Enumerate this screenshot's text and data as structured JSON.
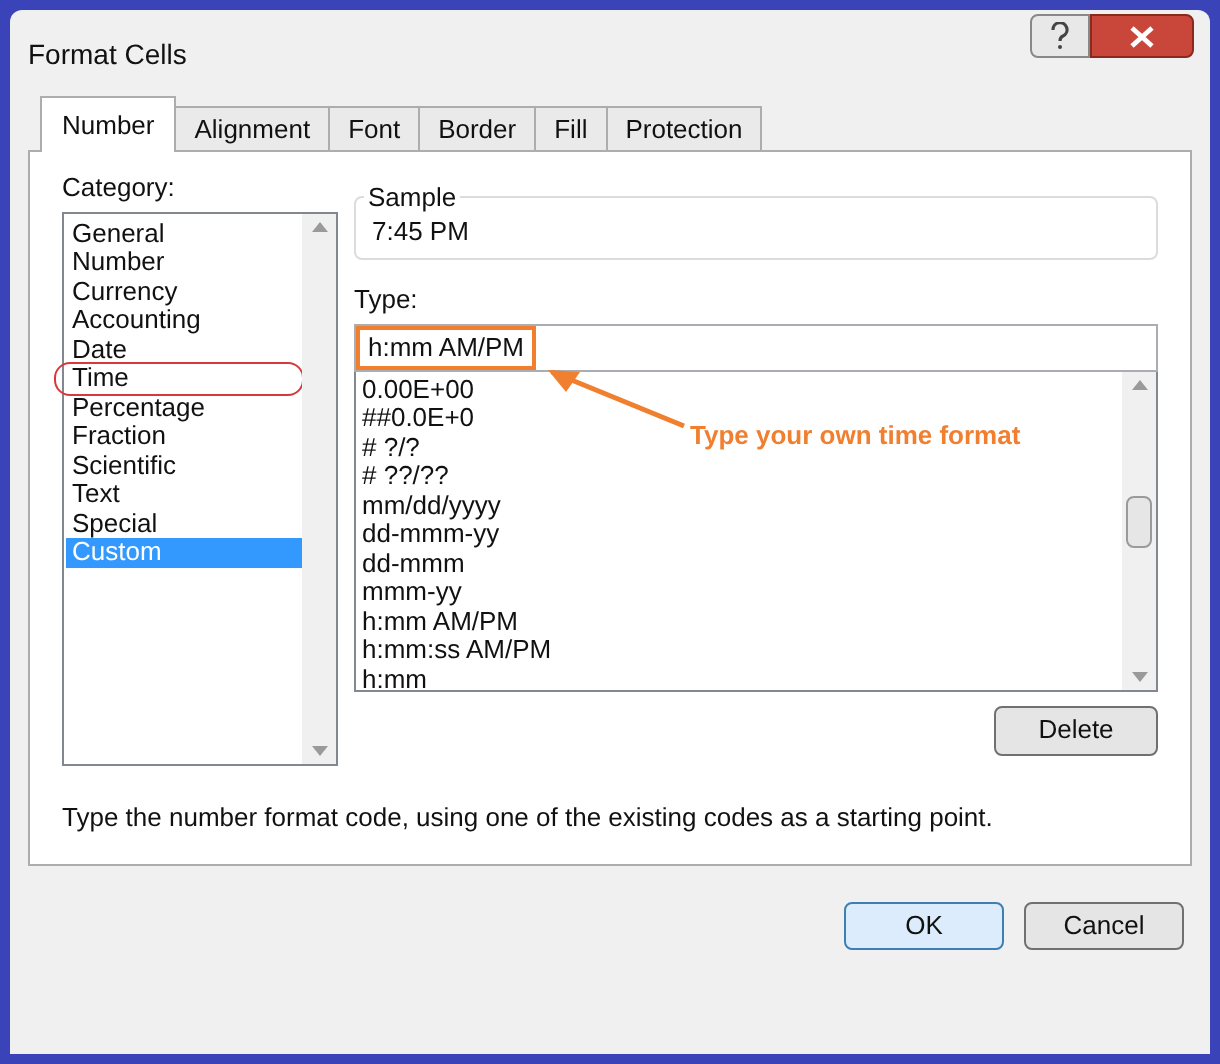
{
  "window": {
    "title": "Format Cells"
  },
  "tabs": [
    {
      "label": "Number",
      "selected": true
    },
    {
      "label": "Alignment",
      "selected": false
    },
    {
      "label": "Font",
      "selected": false
    },
    {
      "label": "Border",
      "selected": false
    },
    {
      "label": "Fill",
      "selected": false
    },
    {
      "label": "Protection",
      "selected": false
    }
  ],
  "category": {
    "label": "Category:",
    "items": [
      {
        "label": "General",
        "selected": false,
        "circled": false
      },
      {
        "label": "Number",
        "selected": false,
        "circled": false
      },
      {
        "label": "Currency",
        "selected": false,
        "circled": false
      },
      {
        "label": "Accounting",
        "selected": false,
        "circled": false
      },
      {
        "label": "Date",
        "selected": false,
        "circled": false
      },
      {
        "label": "Time",
        "selected": false,
        "circled": true
      },
      {
        "label": "Percentage",
        "selected": false,
        "circled": false
      },
      {
        "label": "Fraction",
        "selected": false,
        "circled": false
      },
      {
        "label": "Scientific",
        "selected": false,
        "circled": false
      },
      {
        "label": "Text",
        "selected": false,
        "circled": false
      },
      {
        "label": "Special",
        "selected": false,
        "circled": false
      },
      {
        "label": "Custom",
        "selected": true,
        "circled": false
      }
    ]
  },
  "sample": {
    "label": "Sample",
    "value": "7:45 PM"
  },
  "type": {
    "label": "Type:",
    "value": "h:mm AM/PM",
    "highlighted": true,
    "callout": "Type your own time format",
    "formats": [
      "0.00E+00",
      "##0.0E+0",
      "# ?/?",
      "# ??/??",
      "mm/dd/yyyy",
      "dd-mmm-yy",
      "dd-mmm",
      "mmm-yy",
      "h:mm AM/PM",
      "h:mm:ss AM/PM",
      "h:mm"
    ]
  },
  "delete_button": "Delete",
  "description": "Type the number format code, using one of the existing codes as a starting point.",
  "buttons": [
    "OK",
    "Cancel"
  ]
}
